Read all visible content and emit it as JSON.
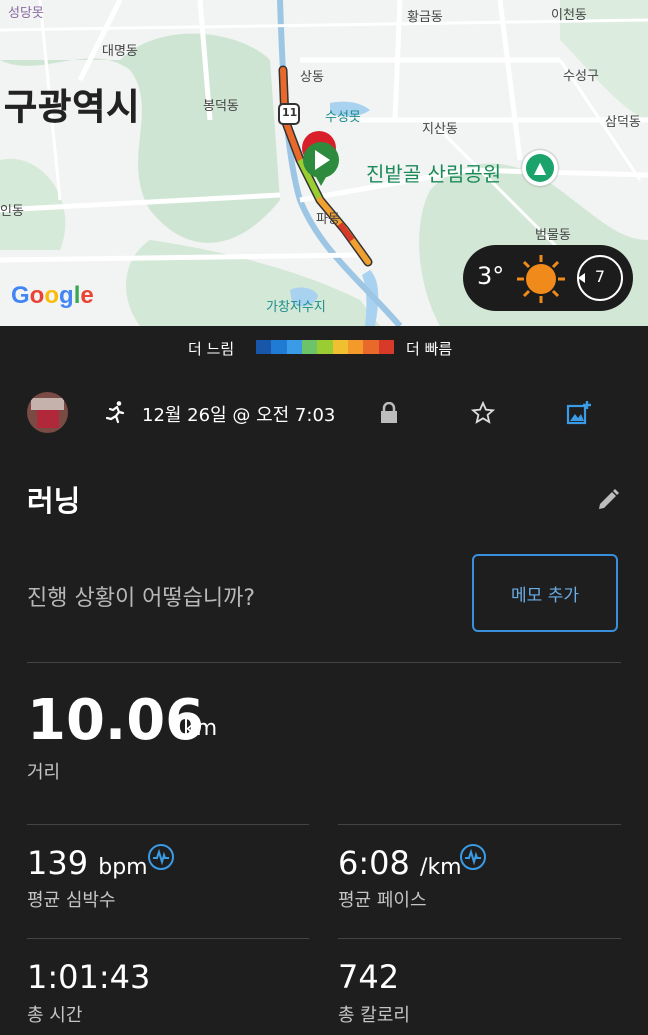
{
  "map": {
    "city_label": "구광역시",
    "labels": [
      "성당못",
      "대명동",
      "봉덕동",
      "인동",
      "상동",
      "수성못",
      "파동",
      "가창저수지",
      "황금동",
      "이천동",
      "수성구",
      "지산동",
      "삼덕동",
      "범물동"
    ],
    "route_number": "11",
    "park_label": "진밭골 산림공원",
    "google_logo": [
      "G",
      "o",
      "o",
      "g",
      "l",
      "e"
    ],
    "google_colors": [
      "#4285F4",
      "#EA4335",
      "#FBBC05",
      "#4285F4",
      "#34A853",
      "#EA4335"
    ]
  },
  "weather": {
    "temp": "3°",
    "wind": "7",
    "icon": "sun-icon"
  },
  "legend": {
    "slow": "더 느림",
    "fast": "더 빠름",
    "colors": [
      "#1756a9",
      "#1f7bd3",
      "#3a9be6",
      "#6cc36a",
      "#9acd32",
      "#f0c030",
      "#f39a2a",
      "#e8692a",
      "#d83a2a"
    ]
  },
  "activity": {
    "date": "12월 26일 @ 오전 7:03",
    "title": "러닝",
    "prompt": "진행 상황이 어떻습니까?",
    "memo_button": "메모 추가",
    "distance": {
      "value": "10.06",
      "unit": "km",
      "label": "거리"
    },
    "heart_rate": {
      "value": "139",
      "unit": "bpm",
      "label": "평균 심박수"
    },
    "pace": {
      "value": "6:08",
      "unit": "/km",
      "label": "평균 페이스"
    },
    "time": {
      "value": "1:01:43",
      "label": "총 시간"
    },
    "calories": {
      "value": "742",
      "label": "총 칼로리"
    }
  },
  "colors": {
    "accent": "#3a8fdc",
    "background": "#1e1e1e"
  }
}
